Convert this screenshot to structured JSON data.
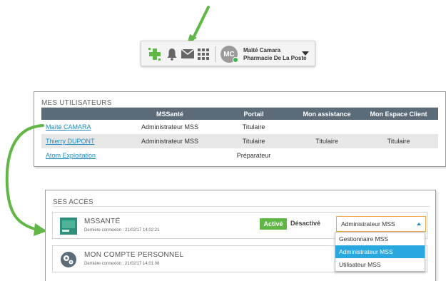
{
  "toolbar": {
    "avatar_initials": "MC",
    "user_name": "Maïté Camara",
    "pharmacy": "Pharmacie De La Poste",
    "icons": [
      "pharmacy-plus-icon",
      "bell-icon",
      "mail-icon",
      "apps-grid-icon",
      "chevron-down-icon"
    ],
    "colors": {
      "accent_green": "#61b746",
      "status_green": "#3ab54a"
    }
  },
  "users": {
    "title": "MES UTILISATEURS",
    "columns": [
      "",
      "MSSanté",
      "Portail",
      "Mon assistance",
      "Mon Espace Client"
    ],
    "rows": [
      {
        "name": "Maïté CAMARA",
        "mss": "Administrateur MSS",
        "portail": "Titulaire",
        "assistance": "",
        "client": ""
      },
      {
        "name": "Thierry DUPONT",
        "mss": "Administrateur MSS",
        "portail": "Titulaire",
        "assistance": "Titulaire",
        "client": "Titulaire"
      },
      {
        "name": "Atom Exploitation",
        "mss": "",
        "portail": "Préparateur",
        "assistance": "",
        "client": ""
      }
    ],
    "colors": {
      "header_bg": "#5b6b78",
      "link": "#1e8bc3"
    }
  },
  "access": {
    "title": "SES ACCÈS",
    "mss": {
      "label": "MSSANTÉ",
      "last_login": "Dernière connexion : 21/02/17 14:02:21",
      "active_label": "Activé",
      "inactive_label": "Désactivé",
      "selected_role": "Administrateur MSS"
    },
    "perso": {
      "label": "MON COMPTE PERSONNEL",
      "last_login": "Dernière connexion : 21/02/17 14:01:08"
    },
    "role_options": [
      "Gestionnaire MSS",
      "Administrateur MSS",
      "Utilisateur MSS"
    ],
    "highlighted_option": "Administrateur MSS",
    "colors": {
      "select_border": "#f0a94a",
      "highlight": "#29a8e0"
    }
  }
}
